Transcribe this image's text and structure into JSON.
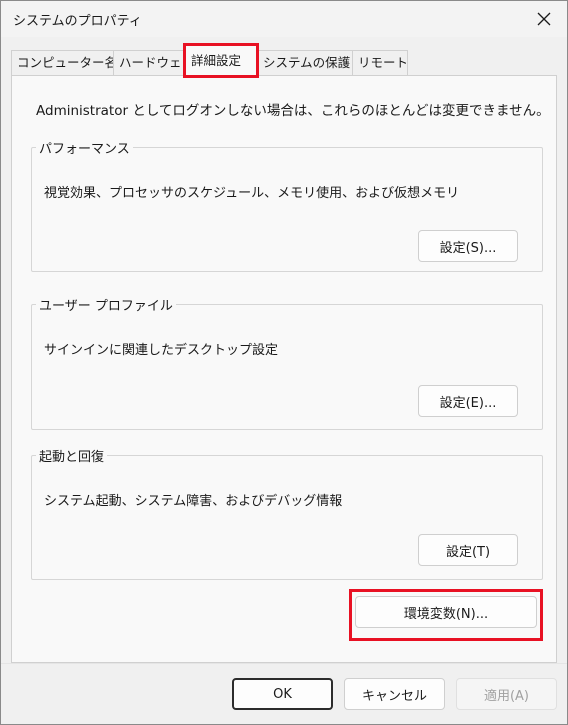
{
  "window": {
    "title": "システムのプロパティ"
  },
  "tabs": [
    {
      "label": "コンピューター名"
    },
    {
      "label": "ハードウェア"
    },
    {
      "label": "詳細設定"
    },
    {
      "label": "システムの保護"
    },
    {
      "label": "リモート"
    }
  ],
  "panel": {
    "intro": "Administrator としてログオンしない場合は、これらのほとんどは変更できません。",
    "performance": {
      "legend": "パフォーマンス",
      "description": "視覚効果、プロセッサのスケジュール、メモリ使用、および仮想メモリ",
      "button": "設定(S)..."
    },
    "profile": {
      "legend": "ユーザー プロファイル",
      "description": "サインインに関連したデスクトップ設定",
      "button": "設定(E)..."
    },
    "startup": {
      "legend": "起動と回復",
      "description": "システム起動、システム障害、およびデバッグ情報",
      "button": "設定(T)"
    },
    "env_button": "環境変数(N)..."
  },
  "footer": {
    "ok": "OK",
    "cancel": "キャンセル",
    "apply": "適用(A)"
  },
  "colors": {
    "highlight": "#e81123",
    "panel_bg": "#f9f9f9",
    "window_bg": "#f0f0f0"
  }
}
